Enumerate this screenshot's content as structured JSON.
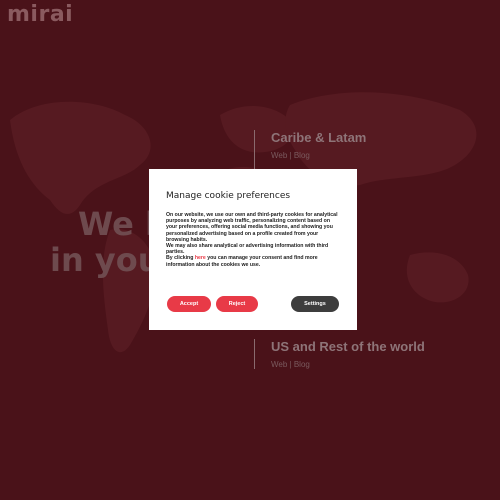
{
  "brand": {
    "logo": "mirai"
  },
  "hero": {
    "line1": "We b",
    "line2": "in your"
  },
  "regions": [
    {
      "title": "Caribe & Latam",
      "link_web": "Web",
      "separator": " | ",
      "link_blog": "Blog"
    },
    {
      "title": "US and Rest of the world",
      "link_web": "Web",
      "separator": " | ",
      "link_blog": "Blog"
    }
  ],
  "cookie_modal": {
    "title": "Manage cookie preferences",
    "paragraph1": "On our website, we use our own and third-party cookies for analytical purposes by analyzing web traffic, personalizing content based on your preferences, offering social media functions, and showing you personalized advertising based on a profile created from your browsing habits.",
    "paragraph2": "We may also share analytical or advertising information with third parties.",
    "paragraph3_before": "By clicking ",
    "paragraph3_link": "here",
    "paragraph3_after": " you can manage your consent and find more information about the cookies we use.",
    "accept_label": "Accept",
    "reject_label": "Reject",
    "settings_label": "Settings"
  },
  "colors": {
    "background": "#4a1219",
    "accent": "#e83a47",
    "settings_button": "#3d3d3d"
  }
}
